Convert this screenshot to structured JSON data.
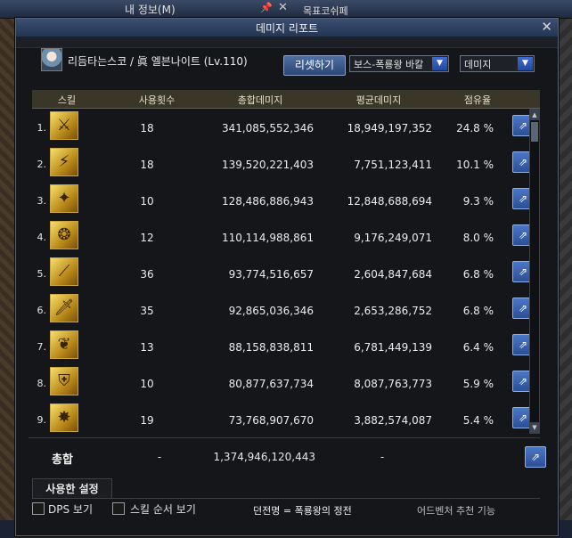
{
  "background": {
    "title": "내 정보(M)",
    "right_label": "목표코쉬페"
  },
  "dialog": {
    "title": "데미지 리포트",
    "character": "리듬타는스코 / 眞 엘븐나이트 (Lv.110)",
    "reset_label": "리셋하기",
    "boss_select": "보스-폭룡왕 바칼",
    "type_select": "데미지"
  },
  "table": {
    "headers": [
      "스킬",
      "사용횟수",
      "총합데미지",
      "평균데미지",
      "점유율"
    ],
    "rows": [
      {
        "num": "1.",
        "count": "18",
        "total": "341,085,552,346",
        "avg": "18,949,197,352",
        "share": "24.8 %"
      },
      {
        "num": "2.",
        "count": "18",
        "total": "139,520,221,403",
        "avg": "7,751,123,411",
        "share": "10.1 %"
      },
      {
        "num": "3.",
        "count": "10",
        "total": "128,486,886,943",
        "avg": "12,848,688,694",
        "share": "9.3 %"
      },
      {
        "num": "4.",
        "count": "12",
        "total": "110,114,988,861",
        "avg": "9,176,249,071",
        "share": "8.0 %"
      },
      {
        "num": "5.",
        "count": "36",
        "total": "93,774,516,657",
        "avg": "2,604,847,684",
        "share": "6.8 %"
      },
      {
        "num": "6.",
        "count": "35",
        "total": "92,865,036,346",
        "avg": "2,653,286,752",
        "share": "6.8 %"
      },
      {
        "num": "7.",
        "count": "13",
        "total": "88,158,838,811",
        "avg": "6,781,449,139",
        "share": "6.4 %"
      },
      {
        "num": "8.",
        "count": "10",
        "total": "80,877,637,734",
        "avg": "8,087,763,773",
        "share": "5.9 %"
      },
      {
        "num": "9.",
        "count": "19",
        "total": "73,768,907,670",
        "avg": "3,882,574,087",
        "share": "5.4 %"
      }
    ]
  },
  "totals": {
    "label": "총합",
    "count": "-",
    "total": "1,374,946,120,443",
    "avg": "-"
  },
  "settings_tab": "사용한 설정",
  "footer": {
    "dps_label": "DPS 보기",
    "order_label": "스킬 순서 보기",
    "dungeon": "던전명 = 폭룡왕의 정전",
    "right": "어드벤처 추천 기능"
  },
  "icons": [
    "skill-icon",
    "share-icon",
    "close-icon",
    "chevron-down-icon",
    "pin-icon"
  ],
  "colors": {
    "accent": "#2f54a3",
    "header": "#3a3729"
  }
}
